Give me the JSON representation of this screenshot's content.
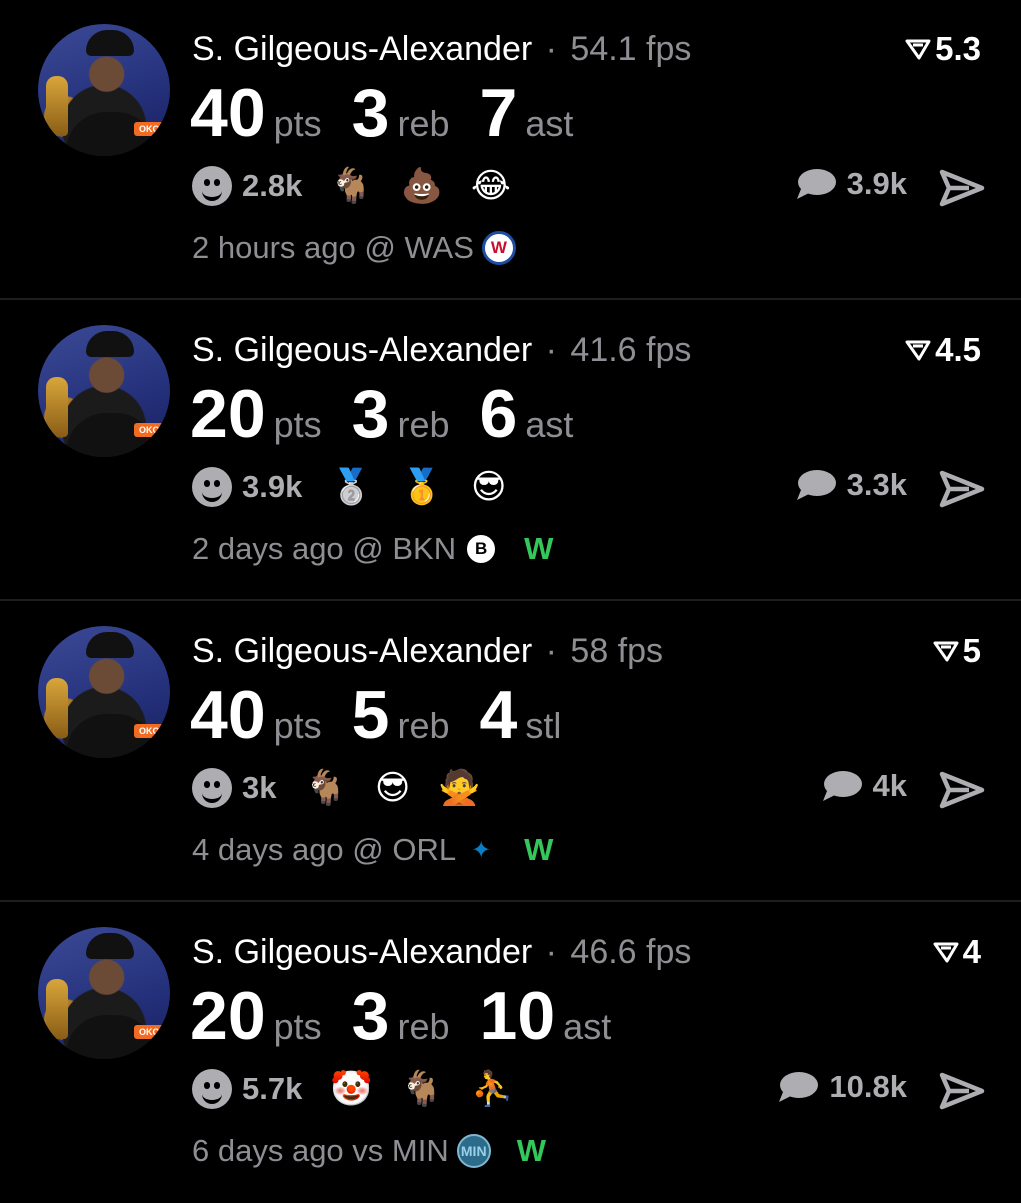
{
  "posts": [
    {
      "player": "S. Gilgeous-Alexander",
      "separator": "·",
      "fps": "54.1 fps",
      "rating": "5.3",
      "stats": [
        {
          "value": "40",
          "unit": "pts"
        },
        {
          "value": "3",
          "unit": "reb"
        },
        {
          "value": "7",
          "unit": "ast"
        }
      ],
      "reaction_count": "2.8k",
      "emojis": [
        "🐐",
        "💩",
        "😂"
      ],
      "comment_count": "3.9k",
      "time": "2 hours ago",
      "venue": "@ WAS",
      "team_logo": "W",
      "result": ""
    },
    {
      "player": "S. Gilgeous-Alexander",
      "separator": "·",
      "fps": "41.6 fps",
      "rating": "4.5",
      "stats": [
        {
          "value": "20",
          "unit": "pts"
        },
        {
          "value": "3",
          "unit": "reb"
        },
        {
          "value": "6",
          "unit": "ast"
        }
      ],
      "reaction_count": "3.9k",
      "emojis": [
        "🥈",
        "🥇",
        "😎"
      ],
      "comment_count": "3.3k",
      "time": "2 days ago",
      "venue": "@ BKN",
      "team_logo": "B",
      "result": "W"
    },
    {
      "player": "S. Gilgeous-Alexander",
      "separator": "·",
      "fps": "58 fps",
      "rating": "5",
      "stats": [
        {
          "value": "40",
          "unit": "pts"
        },
        {
          "value": "5",
          "unit": "reb"
        },
        {
          "value": "4",
          "unit": "stl"
        }
      ],
      "reaction_count": "3k",
      "emojis": [
        "🐐",
        "😎",
        "🙅"
      ],
      "comment_count": "4k",
      "time": "4 days ago",
      "venue": "@ ORL",
      "team_logo": "✦",
      "result": "W"
    },
    {
      "player": "S. Gilgeous-Alexander",
      "separator": "·",
      "fps": "46.6 fps",
      "rating": "4",
      "stats": [
        {
          "value": "20",
          "unit": "pts"
        },
        {
          "value": "3",
          "unit": "reb"
        },
        {
          "value": "10",
          "unit": "ast"
        }
      ],
      "reaction_count": "5.7k",
      "emojis": [
        "🤡",
        "🐐",
        "⛹"
      ],
      "comment_count": "10.8k",
      "time": "6 days ago",
      "venue": "vs MIN",
      "team_logo": "MIN",
      "result": "W"
    }
  ],
  "colors": {
    "background": "#000000",
    "muted": "#8e8e93",
    "win": "#34c759"
  },
  "icons": {
    "rating": "filter-v-icon",
    "reaction": "smiley-icon",
    "comment": "speech-bubble-icon",
    "share": "paper-plane-icon"
  }
}
